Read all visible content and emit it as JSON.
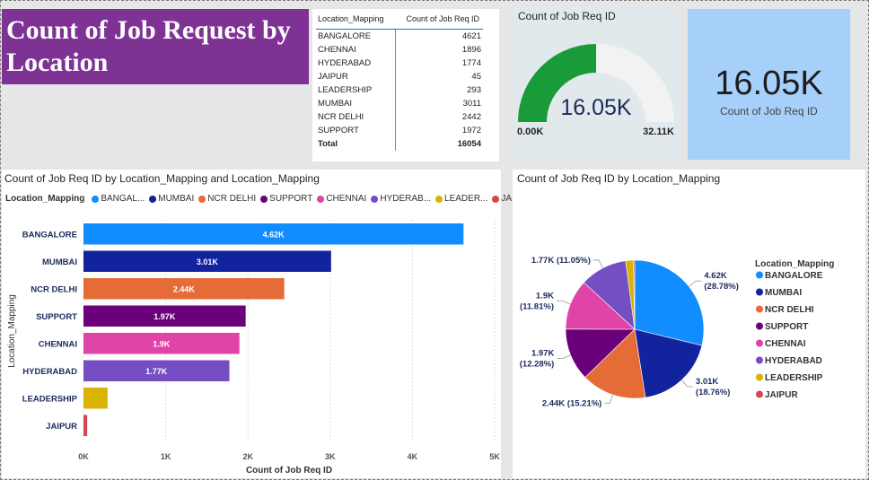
{
  "page_title": "Count of Job Request by Location",
  "table": {
    "headers": [
      "Location_Mapping",
      "Count of Job Req ID"
    ],
    "rows": [
      [
        "BANGALORE",
        "4621"
      ],
      [
        "CHENNAI",
        "1896"
      ],
      [
        "HYDERABAD",
        "1774"
      ],
      [
        "JAIPUR",
        "45"
      ],
      [
        "LEADERSHIP",
        "293"
      ],
      [
        "MUMBAI",
        "3011"
      ],
      [
        "NCR DELHI",
        "2442"
      ],
      [
        "SUPPORT",
        "1972"
      ]
    ],
    "total": [
      "Total",
      "16054"
    ]
  },
  "gauge": {
    "title": "Count of Job Req ID",
    "value_label": "16.05K",
    "min_label": "0.00K",
    "max_label": "32.11K",
    "fraction": 0.5,
    "fill_color": "#1a9b3a",
    "track_color": "#f2f2f2"
  },
  "card": {
    "value": "16.05K",
    "label": "Count of Job Req ID"
  },
  "colors": {
    "BANGALORE": "#118dff",
    "MUMBAI": "#12239e",
    "NCR DELHI": "#e66c37",
    "SUPPORT": "#6b007b",
    "CHENNAI": "#e044a7",
    "HYDERABAD": "#744ec2",
    "LEADERSHIP": "#d9b300",
    "JAIPUR": "#d64550"
  },
  "chart_data": [
    {
      "type": "bar",
      "orientation": "horizontal",
      "title": "Count of Job Req ID by Location_Mapping and Location_Mapping",
      "legend_title": "Location_Mapping",
      "legend_entries": [
        "BANGAL...",
        "MUMBAI",
        "NCR DELHI",
        "SUPPORT",
        "CHENNAI",
        "HYDERAB...",
        "LEADER...",
        "JAIPUR"
      ],
      "legend_keys": [
        "BANGALORE",
        "MUMBAI",
        "NCR DELHI",
        "SUPPORT",
        "CHENNAI",
        "HYDERABAD",
        "LEADERSHIP",
        "JAIPUR"
      ],
      "legend_placement": "top",
      "categories": [
        "BANGALORE",
        "MUMBAI",
        "NCR DELHI",
        "SUPPORT",
        "CHENNAI",
        "HYDERABAD",
        "LEADERSHIP",
        "JAIPUR"
      ],
      "values": [
        4621,
        3011,
        2442,
        1972,
        1896,
        1774,
        293,
        45
      ],
      "data_labels": [
        "4.62K",
        "3.01K",
        "2.44K",
        "1.97K",
        "1.9K",
        "1.77K",
        "",
        ""
      ],
      "xlabel": "Count of Job Req ID",
      "ylabel": "Location_Mapping",
      "xlim": [
        0,
        5000
      ],
      "xticks": [
        0,
        1000,
        2000,
        3000,
        4000,
        5000
      ],
      "xtick_labels": [
        "0K",
        "1K",
        "2K",
        "3K",
        "4K",
        "5K"
      ],
      "grid": true
    },
    {
      "type": "pie",
      "title": "Count of Job Req ID by Location_Mapping",
      "legend_title": "Location_Mapping",
      "legend_placement": "right",
      "categories": [
        "BANGALORE",
        "MUMBAI",
        "NCR DELHI",
        "SUPPORT",
        "CHENNAI",
        "HYDERABAD",
        "LEADERSHIP",
        "JAIPUR"
      ],
      "values": [
        4621,
        3011,
        2442,
        1972,
        1896,
        1774,
        293,
        45
      ],
      "labels": [
        {
          "category": "BANGALORE",
          "lines": [
            "4.62K",
            "(28.78%)"
          ]
        },
        {
          "category": "MUMBAI",
          "lines": [
            "3.01K",
            "(18.76%)"
          ]
        },
        {
          "category": "NCR DELHI",
          "lines": [
            "2.44K (15.21%)"
          ]
        },
        {
          "category": "SUPPORT",
          "lines": [
            "1.97K",
            "(12.28%)"
          ]
        },
        {
          "category": "CHENNAI",
          "lines": [
            "1.9K",
            "(11.81%)"
          ]
        },
        {
          "category": "HYDERABAD",
          "lines": [
            "1.77K (11.05%)"
          ]
        }
      ]
    }
  ]
}
